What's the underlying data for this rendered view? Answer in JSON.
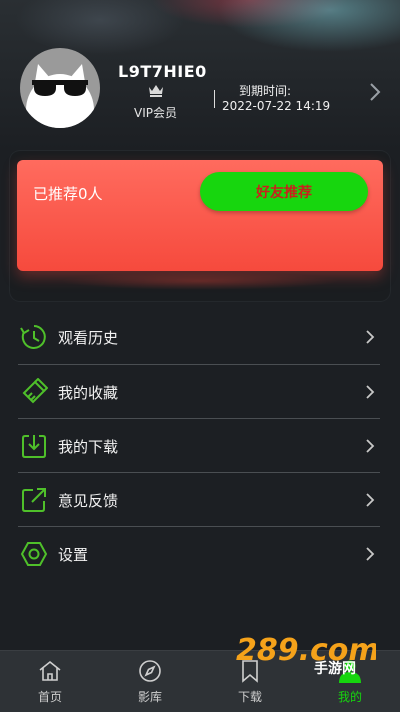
{
  "profile": {
    "username": "L9T7HIE0",
    "vip_label": "VIP会员",
    "expiry_label": "到期时间:",
    "expiry_date": "2022-07-22 14:19"
  },
  "referral": {
    "count_text": "已推荐0人",
    "button_label": "好友推荐"
  },
  "menu": {
    "items": [
      {
        "label": "观看历史",
        "icon": "history-icon"
      },
      {
        "label": "我的收藏",
        "icon": "favorites-icon"
      },
      {
        "label": "我的下载",
        "icon": "download-icon"
      },
      {
        "label": "意见反馈",
        "icon": "feedback-icon"
      },
      {
        "label": "设置",
        "icon": "settings-icon"
      }
    ]
  },
  "tabbar": {
    "tabs": [
      {
        "label": "首页",
        "icon": "home-icon",
        "active": false
      },
      {
        "label": "影库",
        "icon": "compass-icon",
        "active": false
      },
      {
        "label": "下载",
        "icon": "bookmark-icon",
        "active": false
      },
      {
        "label": "我的",
        "icon": "user-icon",
        "active": true
      }
    ]
  },
  "watermark": {
    "text": "289.com",
    "subtext": "手游网"
  },
  "colors": {
    "accent_green": "#16d60e",
    "card_red": "#f64a3d",
    "button_text_red": "#c8221d"
  }
}
